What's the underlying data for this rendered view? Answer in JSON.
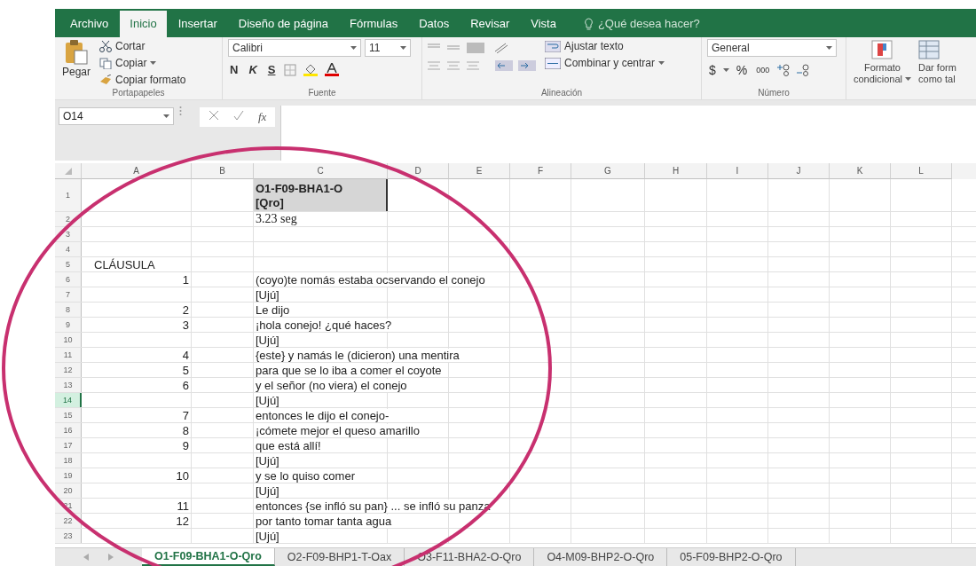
{
  "tabs": [
    {
      "label": "Archivo",
      "selected": false
    },
    {
      "label": "Inicio",
      "selected": true
    },
    {
      "label": "Insertar",
      "selected": false
    },
    {
      "label": "Diseño de página",
      "selected": false
    },
    {
      "label": "Fórmulas",
      "selected": false
    },
    {
      "label": "Datos",
      "selected": false
    },
    {
      "label": "Revisar",
      "selected": false
    },
    {
      "label": "Vista",
      "selected": false
    }
  ],
  "tell_me": {
    "placeholder": "¿Qué desea hacer?"
  },
  "ribbon": {
    "clipboard": {
      "paste": "Pegar",
      "cut": "Cortar",
      "copy": "Copiar",
      "format_painter": "Copiar formato",
      "group": "Portapapeles"
    },
    "font": {
      "name": "Calibri",
      "size": "11",
      "bold": "N",
      "italic": "K",
      "underline": "S",
      "group": "Fuente"
    },
    "alignment": {
      "wrap": "Ajustar texto",
      "merge": "Combinar y centrar",
      "group": "Alineación"
    },
    "number": {
      "format": "General",
      "currency": "$",
      "percent": "%",
      "thousands": "000",
      "group": "Número"
    },
    "styles": {
      "conditional_top": "Formato",
      "conditional_bottom": "condicional",
      "table_top": "Dar form",
      "table_bottom": "como tal"
    }
  },
  "formula_bar": {
    "name_box": "O14",
    "function_label": "fx"
  },
  "columns": [
    "A",
    "B",
    "C",
    "D",
    "E",
    "F",
    "G",
    "H",
    "I",
    "J",
    "K",
    "L"
  ],
  "rows": [
    {
      "number": "1",
      "selected": false,
      "kind": "title",
      "col_c": "O1-F09-BHA1-O [Qro]"
    },
    {
      "number": "2",
      "selected": false,
      "kind": "note",
      "col_c": "3.23 seg"
    },
    {
      "number": "3",
      "selected": false,
      "kind": "plain"
    },
    {
      "number": "4",
      "selected": false,
      "kind": "plain"
    },
    {
      "number": "5",
      "selected": false,
      "kind": "heading",
      "col_a": "CLÁUSULA"
    },
    {
      "number": "6",
      "selected": false,
      "kind": "plain",
      "col_a": "1",
      "col_c": "(coyo)te nomás estaba ocservando el conejo"
    },
    {
      "number": "7",
      "selected": false,
      "kind": "plain",
      "col_c": "[Ujú]"
    },
    {
      "number": "8",
      "selected": false,
      "kind": "plain",
      "col_a": "2",
      "col_c": "Le dijo"
    },
    {
      "number": "9",
      "selected": false,
      "kind": "plain",
      "col_a": "3",
      "col_c": "¡hola conejo! ¿qué haces?"
    },
    {
      "number": "10",
      "selected": false,
      "kind": "plain",
      "col_c": "[Ujú]"
    },
    {
      "number": "11",
      "selected": false,
      "kind": "plain",
      "col_a": "4",
      "col_c": "{este} y namás le (dicieron) una mentira"
    },
    {
      "number": "12",
      "selected": false,
      "kind": "plain",
      "col_a": "5",
      "col_c": "para que se lo iba a comer el coyote"
    },
    {
      "number": "13",
      "selected": false,
      "kind": "plain",
      "col_a": "6",
      "col_c": "y el señor (no viera) el conejo"
    },
    {
      "number": "14",
      "selected": true,
      "kind": "plain",
      "col_c": "[Ujú]"
    },
    {
      "number": "15",
      "selected": false,
      "kind": "plain",
      "col_a": "7",
      "col_c": "entonces le dijo el conejo-"
    },
    {
      "number": "16",
      "selected": false,
      "kind": "plain",
      "col_a": "8",
      "col_c": "¡cómete mejor el queso amarillo"
    },
    {
      "number": "17",
      "selected": false,
      "kind": "plain",
      "col_a": "9",
      "col_c": "que está allí!"
    },
    {
      "number": "18",
      "selected": false,
      "kind": "plain",
      "col_c": "[Ujú]"
    },
    {
      "number": "19",
      "selected": false,
      "kind": "plain",
      "col_a": "10",
      "col_c": "y se lo quiso comer"
    },
    {
      "number": "20",
      "selected": false,
      "kind": "plain",
      "col_c": "[Ujú]"
    },
    {
      "number": "21",
      "selected": false,
      "kind": "plain",
      "col_a": "11",
      "col_c": "entonces {se infló su pan} ... se infló su panza"
    },
    {
      "number": "22",
      "selected": false,
      "kind": "plain",
      "col_a": "12",
      "col_c": "por tanto tomar tanta agua"
    },
    {
      "number": "23",
      "selected": false,
      "kind": "plain",
      "col_c": "[Ujú]"
    }
  ],
  "sheets": [
    {
      "label": "O1-F09-BHA1-O-Qro",
      "selected": true
    },
    {
      "label": "O2-F09-BHP1-T-Oax",
      "selected": false
    },
    {
      "label": "O3-F11-BHA2-O-Qro",
      "selected": false
    },
    {
      "label": "O4-M09-BHP2-O-Qro",
      "selected": false
    },
    {
      "label": "05-F09-BHP2-O-Qro",
      "selected": false
    }
  ]
}
